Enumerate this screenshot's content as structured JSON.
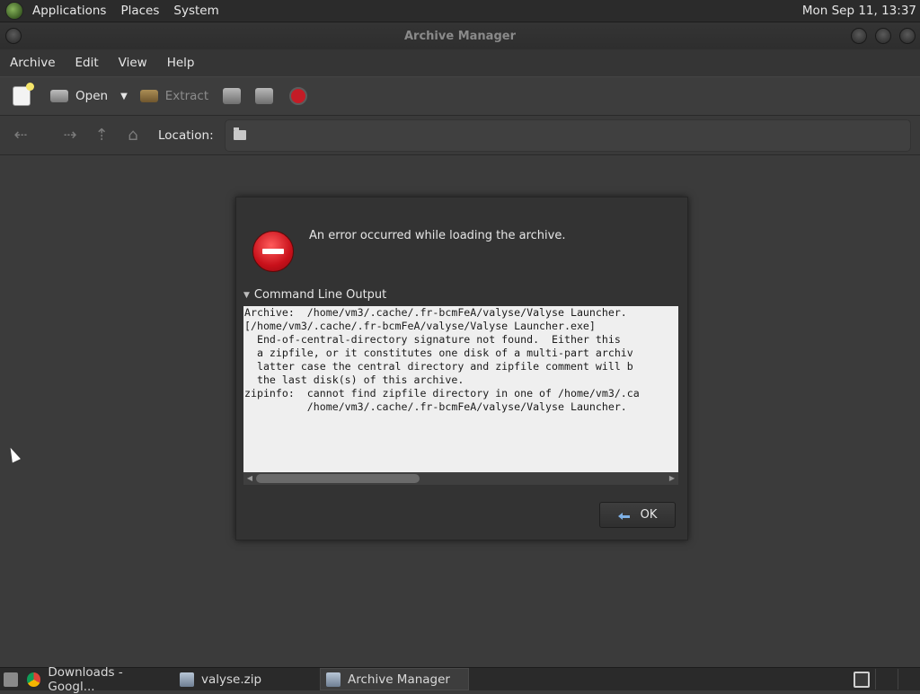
{
  "top_panel": {
    "menu": [
      "Applications",
      "Places",
      "System"
    ],
    "clock": "Mon Sep 11, 13:37"
  },
  "window": {
    "title": "Archive Manager",
    "menubar": [
      "Archive",
      "Edit",
      "View",
      "Help"
    ],
    "toolbar": {
      "open_label": "Open",
      "extract_label": "Extract"
    },
    "location": {
      "label": "Location:",
      "value": ""
    }
  },
  "dialog": {
    "message": "An error occurred while loading the archive.",
    "expander_label": "Command Line Output",
    "output_lines": [
      "Archive:  /home/vm3/.cache/.fr-bcmFeA/valyse/Valyse Launcher.",
      "[/home/vm3/.cache/.fr-bcmFeA/valyse/Valyse Launcher.exe]",
      "  End-of-central-directory signature not found.  Either this",
      "  a zipfile, or it constitutes one disk of a multi-part archiv",
      "  latter case the central directory and zipfile comment will b",
      "  the last disk(s) of this archive.",
      "zipinfo:  cannot find zipfile directory in one of /home/vm3/.ca",
      "          /home/vm3/.cache/.fr-bcmFeA/valyse/Valyse Launcher."
    ],
    "ok_label": "OK"
  },
  "taskbar": {
    "tasks": [
      "Downloads - Googl...",
      "valyse.zip",
      "Archive Manager"
    ]
  },
  "colors": {
    "error_red": "#d0141f",
    "ok_arrow": "#7fb1e6"
  }
}
